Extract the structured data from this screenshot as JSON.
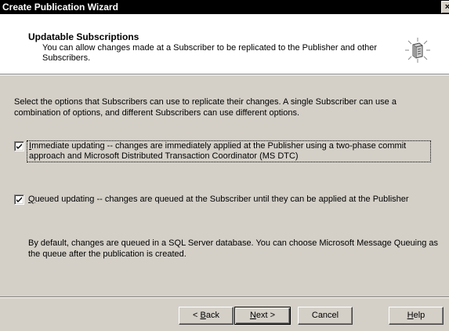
{
  "window": {
    "title": "Create Publication Wizard",
    "close_glyph": "×"
  },
  "header": {
    "title": "Updatable Subscriptions",
    "description": "You can allow changes made at a Subscriber to be replicated to the Publisher and other Subscribers.",
    "icon": "wizard-publication-icon"
  },
  "body": {
    "intro": "Select the options that Subscribers can use to replicate their changes. A single Subscriber can use a combination of options, and different Subscribers can use different options."
  },
  "options": [
    {
      "checked": true,
      "mnemonic": "I",
      "label_rest": "mmediate updating -- changes are immediately applied at the Publisher using a two-phase commit approach and Microsoft Distributed Transaction Coordinator (MS DTC)"
    },
    {
      "checked": true,
      "mnemonic": "Q",
      "label_rest": "ueued updating -- changes are queued at the Subscriber until they can be applied at the Publisher"
    }
  ],
  "note": "By default, changes are queued in a SQL Server database. You can choose Microsoft Message Queuing as the queue after the publication is created.",
  "buttons": {
    "back_prefix": "< ",
    "back_mnemonic": "B",
    "back_rest": "ack",
    "next_mnemonic": "N",
    "next_rest": "ext >",
    "cancel": "Cancel",
    "help_mnemonic": "H",
    "help_rest": "elp"
  }
}
